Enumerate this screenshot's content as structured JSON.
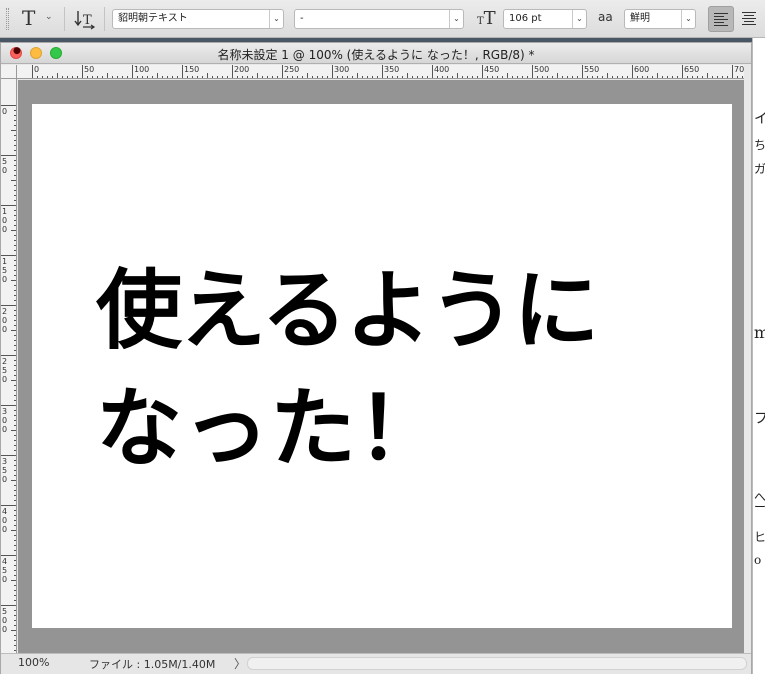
{
  "options_bar": {
    "tool_icon": "type-tool-icon",
    "orientation_icon": "text-orientation-icon",
    "font_family": "貂明朝テキスト",
    "font_style": "-",
    "font_size_icon": "font-size-icon",
    "font_size": "106 pt",
    "antialias_icon": "antialias-icon",
    "antialias_label": "aa",
    "antialias_value": "鮮明",
    "align_left_icon": "align-left-icon",
    "align_center_icon": "align-center-icon"
  },
  "document": {
    "title": "名称未設定 1 @ 100% (使えるように なった！, RGB/8) *",
    "canvas_text_line1": "使えるように",
    "canvas_text_line2": "なった！",
    "zoom": "100%",
    "file_info": "ファイル : 1.05M/1.40M",
    "status_arrow": "〉"
  },
  "ruler_top_labels": [
    "0",
    "50",
    "100",
    "150",
    "200",
    "250",
    "300",
    "350",
    "400",
    "450",
    "500",
    "550",
    "600",
    "650",
    "70"
  ],
  "ruler_left_labels": [
    "0",
    "50",
    "100",
    "150",
    "200",
    "250",
    "300",
    "350",
    "400",
    "450",
    "500"
  ],
  "background_window_glyphs": [
    "イ",
    "ち",
    "ガ",
    "m",
    "フ",
    "へ",
    "ー",
    "ヒ",
    "o"
  ],
  "colors": {
    "close": "#fc605c",
    "minimize": "#fdbc40",
    "maximize": "#34c84a",
    "pasteboard": "#949494",
    "canvas": "#ffffff"
  }
}
